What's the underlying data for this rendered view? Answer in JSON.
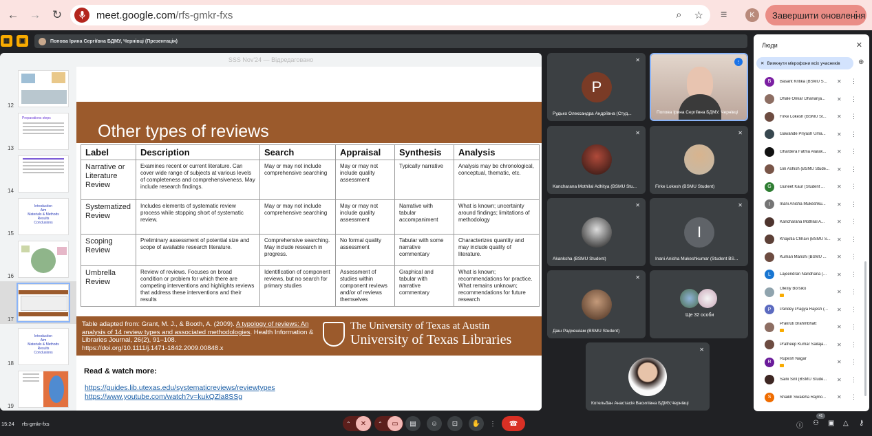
{
  "browser": {
    "url_host": "meet.google.com",
    "url_path": "/rfs-gmkr-fxs",
    "profile_initial": "K",
    "end_share_label": "Завершити оновлення",
    "back_icon": "arrow-left-icon",
    "forward_icon": "arrow-right-icon",
    "reload_icon": "reload-icon"
  },
  "meet": {
    "presenter_bar_label": "Попова Ірина Сергіївна БДМУ, Чернівці (Презентація)",
    "time": "15:24",
    "meeting_code": "rfs-gmkr-fxs",
    "participant_badge": "41"
  },
  "presentation": {
    "window_title": "SSS Nov'24 — Відредаговано",
    "thumbnails": [
      {
        "num": "12",
        "title": ""
      },
      {
        "num": "13",
        "title": "Preparations steps"
      },
      {
        "num": "14",
        "title": ""
      },
      {
        "num": "15",
        "title": "Introduction\nAim\nMaterials & Methods\nResults\nConclusions"
      },
      {
        "num": "16",
        "title": ""
      },
      {
        "num": "17",
        "title": ""
      },
      {
        "num": "18",
        "title": "Introduction\nAim\nMaterials & Methods\nResults\nConclusions"
      },
      {
        "num": "19",
        "title": ""
      }
    ],
    "slide": {
      "heading": "Other types of reviews",
      "columns": [
        "Label",
        "Description",
        "Search",
        "Appraisal",
        "Synthesis",
        "Analysis"
      ],
      "rows": [
        [
          "Narrative or Literature Review",
          "Examines recent or current literature. Can cover wide range of subjects at various levels of completeness and comprehensiveness. May include research findings.",
          "May or may not include comprehensive searching",
          "May or may not include quality assessment",
          "Typically narrative",
          "Analysis may be chronological, conceptual, thematic, etc."
        ],
        [
          "Systematized Review",
          "Includes elements of systematic review process while stopping short of systematic review.",
          "May or may not include comprehensive searching",
          "May or may not include quality assessment",
          "Narrative with tabular accompaniment",
          "What is known; uncertainty around findings; limitations of methodology"
        ],
        [
          "Scoping Review",
          "Preliminary assessment of potential size and scope of available research literature.",
          "Comprehensive searching. May include research in progress.",
          "No formal quality assessment",
          "Tabular with some narrative commentary",
          "Characterizes quantity and may include quality of literature."
        ],
        [
          "Umbrella Review",
          "Review of reviews. Focuses on broad condition or problem for which there are competing interventions and highlights reviews that address these interventions and their results",
          "Identification of component reviews, but no search for primary studies",
          "Assessment of studies within component reviews and/or of reviews themselves",
          "Graphical and tabular with narrative commentary",
          "What is known; recommendations for practice. What remains unknown; recommendations for future research"
        ]
      ],
      "citation_prefix": "Table adapted from: Grant, M. J., & Booth, A. (2009). ",
      "citation_title": "A typology of reviews: An analysis of 14 review types and associated methodologies",
      "citation_journal": ". Health Information & Libraries Journal, 26(2), 91–108.",
      "citation_doi": "https://doi.org/10.1111/j.1471-1842.2009.00848.x",
      "logo_line1": "The University of Texas at Austin",
      "logo_line2": "University of Texas Libraries",
      "read_title": "Read & watch more:",
      "link1": "https://guides.lib.utexas.edu/systematicreviews/reviewtypes",
      "link2": "https://www.youtube.com/watch?v=kukQZla8SSg"
    }
  },
  "tiles": [
    {
      "name": "Рудько Олександра Андріївна (Студ...",
      "initial": "P",
      "color": "#7a3b26"
    },
    {
      "name": "Попова Ірина Сергіївна БДМУ, Чернівці",
      "initial": ""
    },
    {
      "name": "Kancharana Mothilal Adhitya (BSMU Stu...",
      "initial": ""
    },
    {
      "name": "Firke Lokesh (BSMU Student)",
      "initial": ""
    },
    {
      "name": "Akanksha (BSMU Student)",
      "initial": ""
    },
    {
      "name": "Inani Anisha Mukeshkumar (Student BS...",
      "initial": "I",
      "color": "#5f6368"
    },
    {
      "name": "Даш Радхешіам (BSMU Student)",
      "initial": ""
    },
    {
      "name": "Ще 32 особи",
      "initial": ""
    },
    {
      "name": "Котельбан Анастасія Василівна БДМУ,Чернівці",
      "initial": ""
    }
  ],
  "people": {
    "title": "Люди",
    "mute_all_label": "Вимкнути мікрофони всіх учасників",
    "list": [
      {
        "name": "Basant Kritika (BSMU S...",
        "initial": "B",
        "color": "#7b1fa2"
      },
      {
        "name": "Dhale Onkar Dhananja...",
        "initial": "",
        "color": "#8d6e63"
      },
      {
        "name": "Firke Lokesh (BSMU St...",
        "initial": "",
        "color": "#6d4c41"
      },
      {
        "name": "Gawande Priyash Uma...",
        "initial": "",
        "color": "#37474f"
      },
      {
        "name": "Ghardera Fatma Alarak...",
        "initial": "",
        "color": "#111111"
      },
      {
        "name": "Giri Ashish (BSMU Stude...",
        "initial": "",
        "color": "#795548"
      },
      {
        "name": "Guneet Kaur (Student ...",
        "initial": "G",
        "color": "#2e7d32"
      },
      {
        "name": "Inani Anisha Mukeshku...",
        "initial": "I",
        "color": "#757575"
      },
      {
        "name": "Kancharana Mothilal A...",
        "initial": "",
        "color": "#4e342e"
      },
      {
        "name": "Khajotia Chhavi (BSMU S...",
        "initial": "",
        "color": "#5d4037"
      },
      {
        "name": "Kumari Manshi (BSMU ...",
        "initial": "",
        "color": "#6d4c41"
      },
      {
        "name": "Lajeendran Nandhana (...",
        "initial": "L",
        "color": "#1976d2"
      },
      {
        "name": "Olexiy Borsiko",
        "initial": "",
        "color": "#90a4ae",
        "tag": true
      },
      {
        "name": "Pandey Pragya Rajesh (...",
        "initial": "P",
        "color": "#5c6bc0"
      },
      {
        "name": "Prakruti Brahmbhatt",
        "initial": "",
        "color": "#8d6e63",
        "tag": true
      },
      {
        "name": "Pratheep Kumar Sailaja...",
        "initial": "",
        "color": "#6d4c41"
      },
      {
        "name": "Rupesh Nagar",
        "initial": "R",
        "color": "#6a1b9a",
        "tag": true
      },
      {
        "name": "Saini Siril (BSMU Stude...",
        "initial": "",
        "color": "#3e2723"
      },
      {
        "name": "Shaikh Swaleha Rajmo...",
        "initial": "S",
        "color": "#ef6c00"
      }
    ]
  }
}
